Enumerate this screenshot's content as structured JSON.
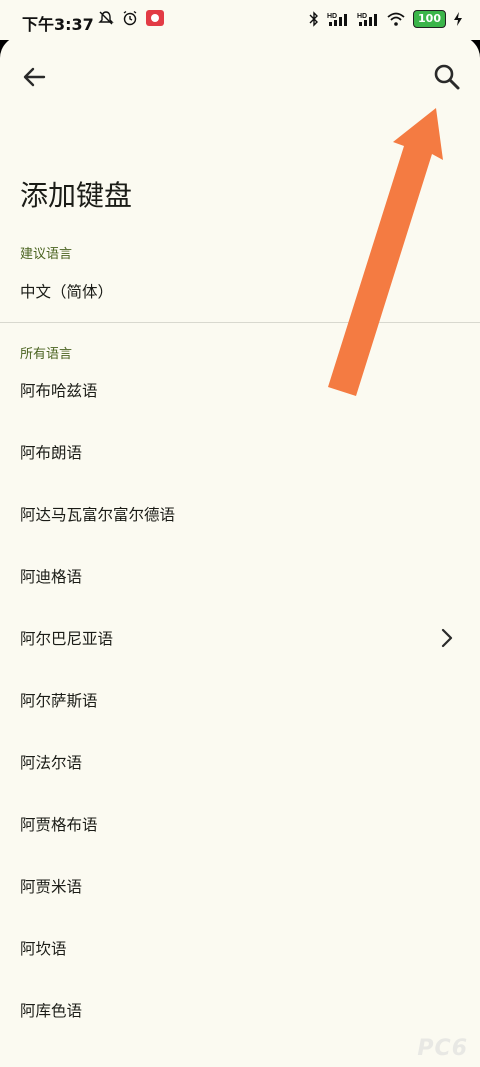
{
  "status_bar": {
    "time": "下午3:37",
    "battery": "100",
    "left_icons": [
      "mute-icon",
      "alarm-icon",
      "app-notification-icon"
    ],
    "right_icons": [
      "bluetooth-icon",
      "hd-signal-icon",
      "hd-signal-icon",
      "wifi-icon",
      "battery-icon",
      "charging-icon"
    ]
  },
  "toolbar": {
    "back_icon": "arrow-left-icon",
    "search_icon": "search-icon"
  },
  "title": "添加键盘",
  "suggested": {
    "header": "建议语言",
    "items": [
      {
        "label": "中文（简体）",
        "has_chevron": false
      }
    ]
  },
  "all": {
    "header": "所有语言",
    "items": [
      {
        "label": "阿布哈兹语",
        "has_chevron": false
      },
      {
        "label": "阿布朗语",
        "has_chevron": false
      },
      {
        "label": "阿达马瓦富尔富尔德语",
        "has_chevron": false
      },
      {
        "label": "阿迪格语",
        "has_chevron": false
      },
      {
        "label": "阿尔巴尼亚语",
        "has_chevron": true
      },
      {
        "label": "阿尔萨斯语",
        "has_chevron": false
      },
      {
        "label": "阿法尔语",
        "has_chevron": false
      },
      {
        "label": "阿贾格布语",
        "has_chevron": false
      },
      {
        "label": "阿贾米语",
        "has_chevron": false
      },
      {
        "label": "阿坎语",
        "has_chevron": false
      },
      {
        "label": "阿库色语",
        "has_chevron": false
      }
    ]
  },
  "colors": {
    "background": "#fbfaf1",
    "section_header": "#4a6320",
    "annotation_arrow": "#f47b42"
  },
  "watermark": "PC6"
}
